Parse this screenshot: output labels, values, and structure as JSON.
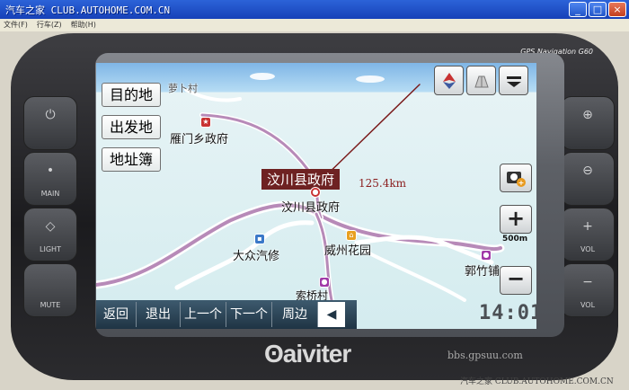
{
  "window": {
    "title": "汽车之家 CLUB.AUTOHOME.COM.CN",
    "menu": [
      "文件(F)",
      "行车(Z)",
      "帮助(H)"
    ],
    "buttons": {
      "minimize": "_",
      "maximize": "□",
      "close": "×"
    }
  },
  "device": {
    "model": "GPS Navigation G60",
    "brand": "aiviter",
    "left_buttons": [
      {
        "label": "",
        "icon": "power-icon"
      },
      {
        "label": "MAIN",
        "icon": "main-icon"
      },
      {
        "label": "LIGHT",
        "icon": "light-icon"
      },
      {
        "label": "MUTE",
        "icon": "mute-icon"
      }
    ],
    "right_buttons": [
      {
        "label": "",
        "icon": "plus-icon"
      },
      {
        "label": "",
        "icon": "minus-icon"
      },
      {
        "label": "VOL",
        "icon": "vol-up-icon"
      },
      {
        "label": "VOL",
        "icon": "vol-down-icon"
      }
    ]
  },
  "screen": {
    "top_left_buttons": [
      "目的地",
      "出发地",
      "地址簿"
    ],
    "top_right_buttons": [
      "compass-icon",
      "view-3d-icon",
      "menu-icon"
    ],
    "destination_label": "汶川县政府",
    "distance": "125.4km",
    "zoom_scale": "500m",
    "clock": "14:01",
    "bottom_buttons": [
      "返回",
      "退出",
      "上一个",
      "下一个",
      "周边"
    ],
    "map_labels": [
      {
        "text": "雁门乡政府",
        "type": "government"
      },
      {
        "text": "汶川县政府",
        "type": "government"
      },
      {
        "text": "大众汽修",
        "type": "auto-repair"
      },
      {
        "text": "威州花园",
        "type": "residential"
      },
      {
        "text": "郭竹铺",
        "type": "town"
      },
      {
        "text": "索桥村",
        "type": "village"
      },
      {
        "text": "萝卜村",
        "type": "village"
      }
    ]
  },
  "watermarks": [
    "bbs.gpsuu.com",
    "汽车之家 CLUB.AUTOHOME.COM.CN"
  ],
  "colors": {
    "route": "#b78ab8",
    "road": "#ffffff",
    "dest_label_bg": "#6e2222",
    "bottom_bar": "#2a4050"
  }
}
